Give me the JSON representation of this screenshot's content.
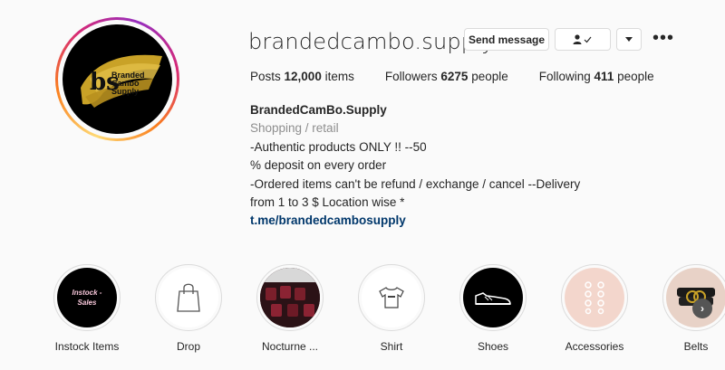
{
  "profile": {
    "username": "brandedcambo.supply",
    "logo_text": "Branded Cambo Supply",
    "buttons": {
      "send_message": "Send message",
      "follow_icon": "person-check-icon",
      "dropdown_icon": "caret-down-icon",
      "more_icon": "more-options-icon"
    },
    "stats": {
      "posts_label": "Posts",
      "posts_value": "12,000",
      "posts_unit": "items",
      "followers_label": "Followers",
      "followers_value": "6275",
      "followers_unit": "people",
      "following_label": "Following",
      "following_value": "411",
      "following_unit": "people"
    },
    "bio": {
      "full_name": "BrandedCamBo.Supply",
      "category": "Shopping / retail",
      "lines": [
        "-Authentic products ONLY !! --50",
        "% deposit on every order",
        "-Ordered items can't be refund / exchange / cancel --Delivery",
        "from 1 to 3 $ Location wise *"
      ],
      "link": "t.me/brandedcambosupply"
    }
  },
  "highlights": [
    {
      "label": "Instock Items",
      "cover_text": "Instock - Sales",
      "bg": "#000000"
    },
    {
      "label": "Drop",
      "icon": "shopping-bag-icon",
      "bg": "#ffffff"
    },
    {
      "label": "Nocturne ...",
      "icon": "photo-icon",
      "bg": "#3b1a1f"
    },
    {
      "label": "Shirt",
      "icon": "tshirt-icon",
      "bg": "#ffffff"
    },
    {
      "label": "Shoes",
      "icon": "sneaker-icon",
      "bg": "#000000"
    },
    {
      "label": "Accessories",
      "icon": "accessories-icon",
      "bg": "#f3d6cc"
    },
    {
      "label": "Belts",
      "icon": "belt-icon",
      "bg": "#e8d2c7"
    }
  ],
  "next_icon": "chevron-right-icon"
}
